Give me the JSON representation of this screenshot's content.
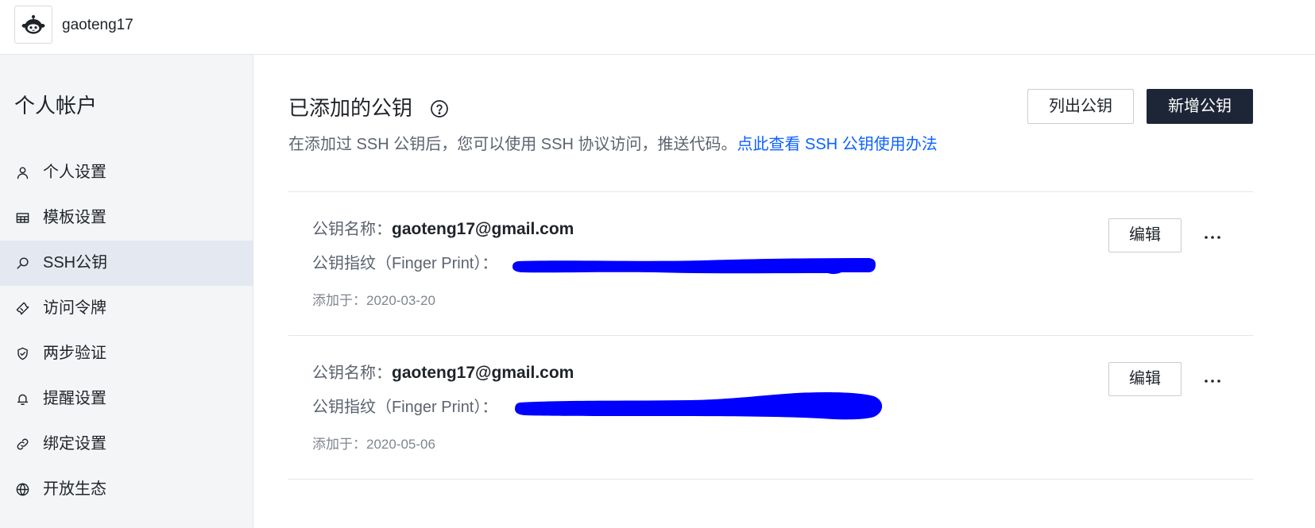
{
  "header": {
    "logo_icon": "octopus-avatar-icon",
    "username": "gaoteng17"
  },
  "sidebar": {
    "title": "个人帐户",
    "items": [
      {
        "label": "个人设置",
        "icon": "user-icon",
        "active": false
      },
      {
        "label": "模板设置",
        "icon": "table-icon",
        "active": false
      },
      {
        "label": "SSH公钥",
        "icon": "search-icon",
        "active": true
      },
      {
        "label": "访问令牌",
        "icon": "ticket-icon",
        "active": false
      },
      {
        "label": "两步验证",
        "icon": "shield-check-icon",
        "active": false
      },
      {
        "label": "提醒设置",
        "icon": "bell-icon",
        "active": false
      },
      {
        "label": "绑定设置",
        "icon": "link-icon",
        "active": false
      },
      {
        "label": "开放生态",
        "icon": "globe-icon",
        "active": false
      }
    ]
  },
  "main": {
    "title": "已添加的公钥",
    "help_icon": "question-circle-icon",
    "list_keys_button": "列出公钥",
    "add_key_button": "新增公钥",
    "description": "在添加过 SSH 公钥后，您可以使用 SSH 协议访问，推送代码。",
    "help_link": "点此查看 SSH 公钥使用办法",
    "keys": [
      {
        "name_label": "公钥名称：",
        "name": "gaoteng17@gmail.com",
        "fingerprint_label": "公钥指纹（Finger Print）：",
        "added_label": "添加于：",
        "added_date": "2020-03-20",
        "edit_label": "编辑",
        "more_icon": "more-horizontal-icon"
      },
      {
        "name_label": "公钥名称：",
        "name": "gaoteng17@gmail.com",
        "fingerprint_label": "公钥指纹（Finger Print）：",
        "added_label": "添加于：",
        "added_date": "2020-05-06",
        "edit_label": "编辑",
        "more_icon": "more-horizontal-icon"
      }
    ]
  },
  "colors": {
    "link": "#0c62ff",
    "primary_button": "#1d2636",
    "sidebar_background": "#f4f5f7",
    "active_item_background": "#e4e8f0",
    "redaction_mark": "#0000ff"
  }
}
